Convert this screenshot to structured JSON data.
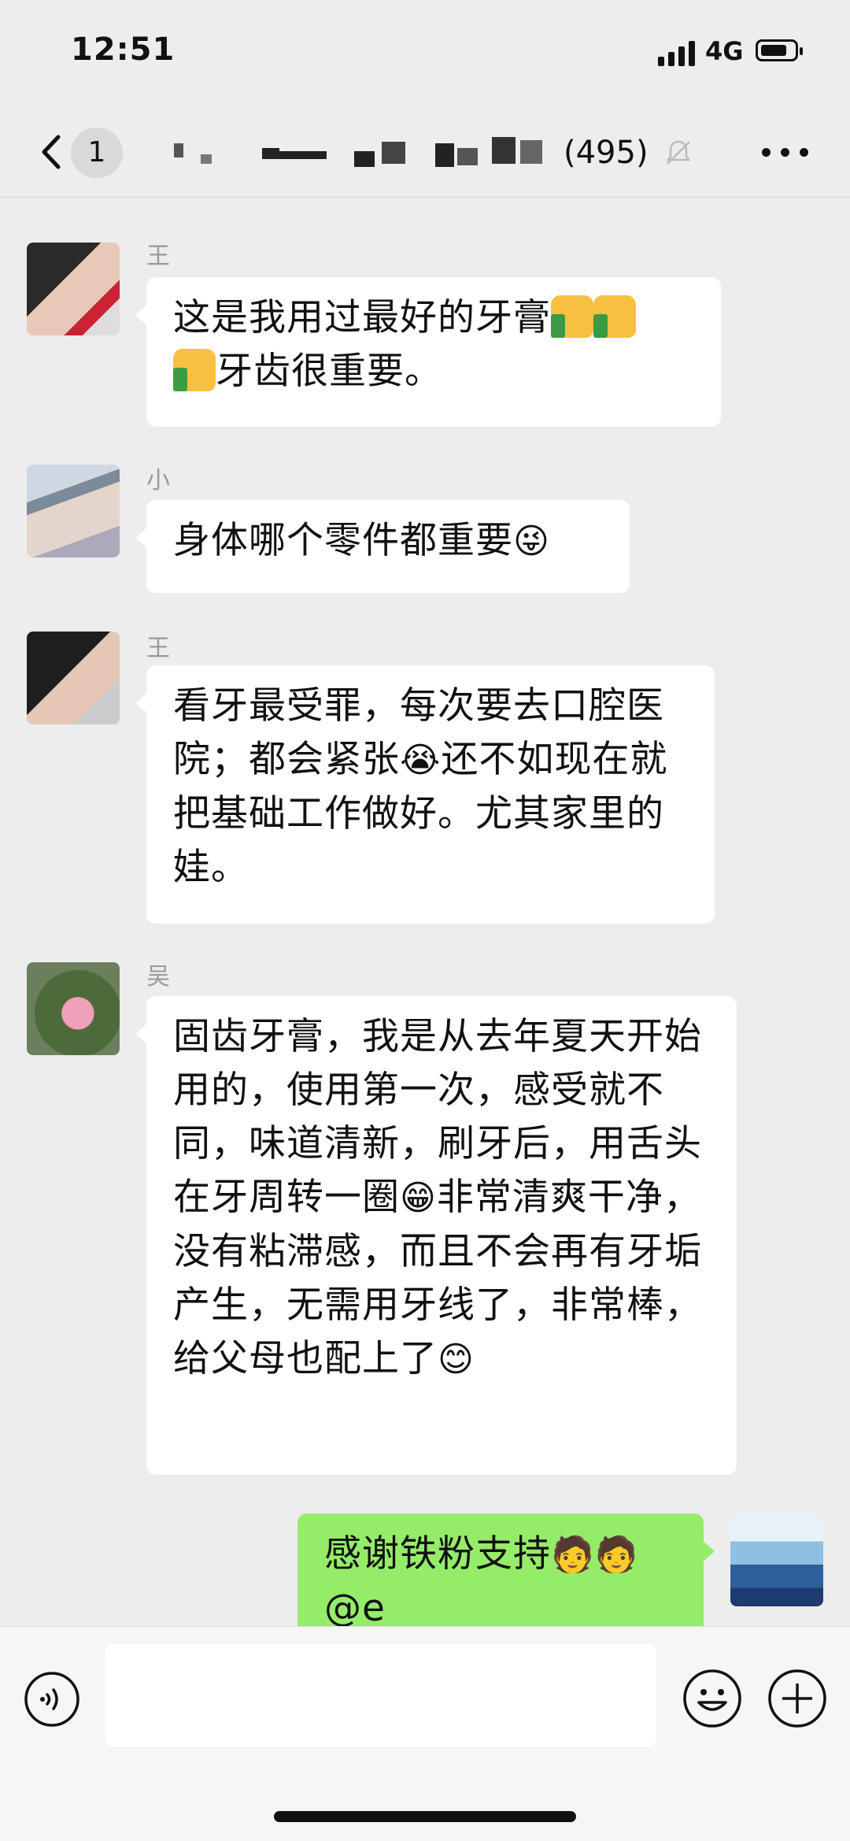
{
  "status_bar": {
    "time": "12:51",
    "network": "4G"
  },
  "nav": {
    "back_count": "1",
    "title_suffix": "(495)"
  },
  "messages": [
    {
      "sender": "王",
      "text_parts": [
        "这是我用过最好的牙膏",
        "牙齿很重要。"
      ]
    },
    {
      "sender": "小",
      "text": "身体哪个零件都重要"
    },
    {
      "sender": "王",
      "text_parts": [
        "看牙最受罪，每次要去口腔医院；都会紧张",
        "还不如现在就把基础工作做好。尤其家里的娃。"
      ]
    },
    {
      "sender": "吴",
      "text_parts": [
        "固齿牙膏，我是从去年夏天开始用的，使用第一次，感受就不同，味道清新，刷牙后，用舌头在牙周转一圈",
        "非常清爽干净，没有粘滞感，而且不会再有牙垢产生，无需用牙线了，非常棒，给父母也配上了"
      ]
    },
    {
      "sender": "",
      "text": "感谢铁粉支持",
      "mention": "@e"
    }
  ],
  "colors": {
    "bg": "#ededed",
    "mine_bubble": "#95ec69",
    "bubble": "#ffffff"
  },
  "icons": [
    "back-icon",
    "mute-icon",
    "more-icon",
    "voice-icon",
    "emoji-icon",
    "plus-icon"
  ]
}
